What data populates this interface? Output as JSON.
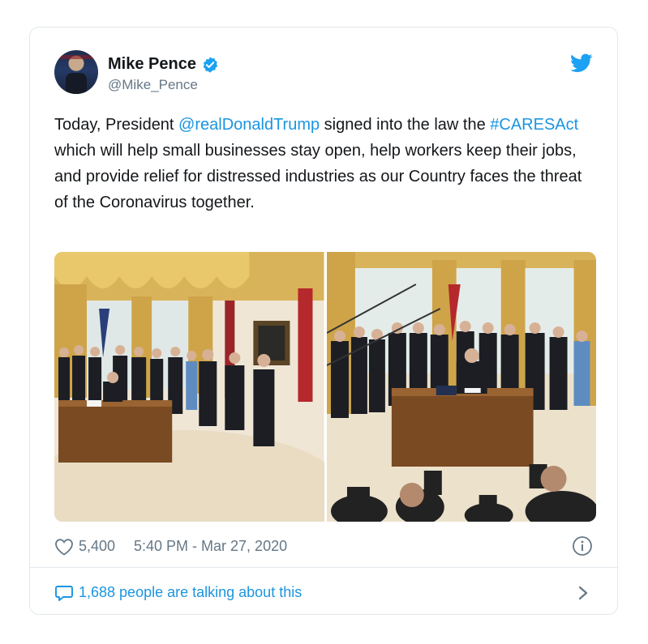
{
  "author": {
    "name": "Mike Pence",
    "handle": "@Mike_Pence",
    "verified": true,
    "avatar_icon": "avatar-photo"
  },
  "tweet": {
    "text_before_mention": "Today, President ",
    "mention": "@realDonaldTrump",
    "text_after_mention": " signed into the law the ",
    "hashtag": "#CARESAct",
    "text_after_hashtag": " which will help small businesses stay open, help workers keep their jobs, and provide relief for distressed industries as our Country faces the threat of the Coronavirus together."
  },
  "media": {
    "photos": [
      "oval-office-group-photo",
      "bill-signing-desk-photo"
    ]
  },
  "meta": {
    "likes": "5,400",
    "timestamp": "5:40 PM - Mar 27, 2020",
    "icons": [
      "heart-icon",
      "info-icon"
    ]
  },
  "footer": {
    "talking": "1,688 people are talking about this",
    "icons": [
      "speech-bubble-icon",
      "chevron-right-icon"
    ]
  },
  "colors": {
    "link": "#1b95e0",
    "secondary_text": "#657786",
    "border": "#e1e8ed",
    "twitter_blue": "#1da1f2"
  }
}
